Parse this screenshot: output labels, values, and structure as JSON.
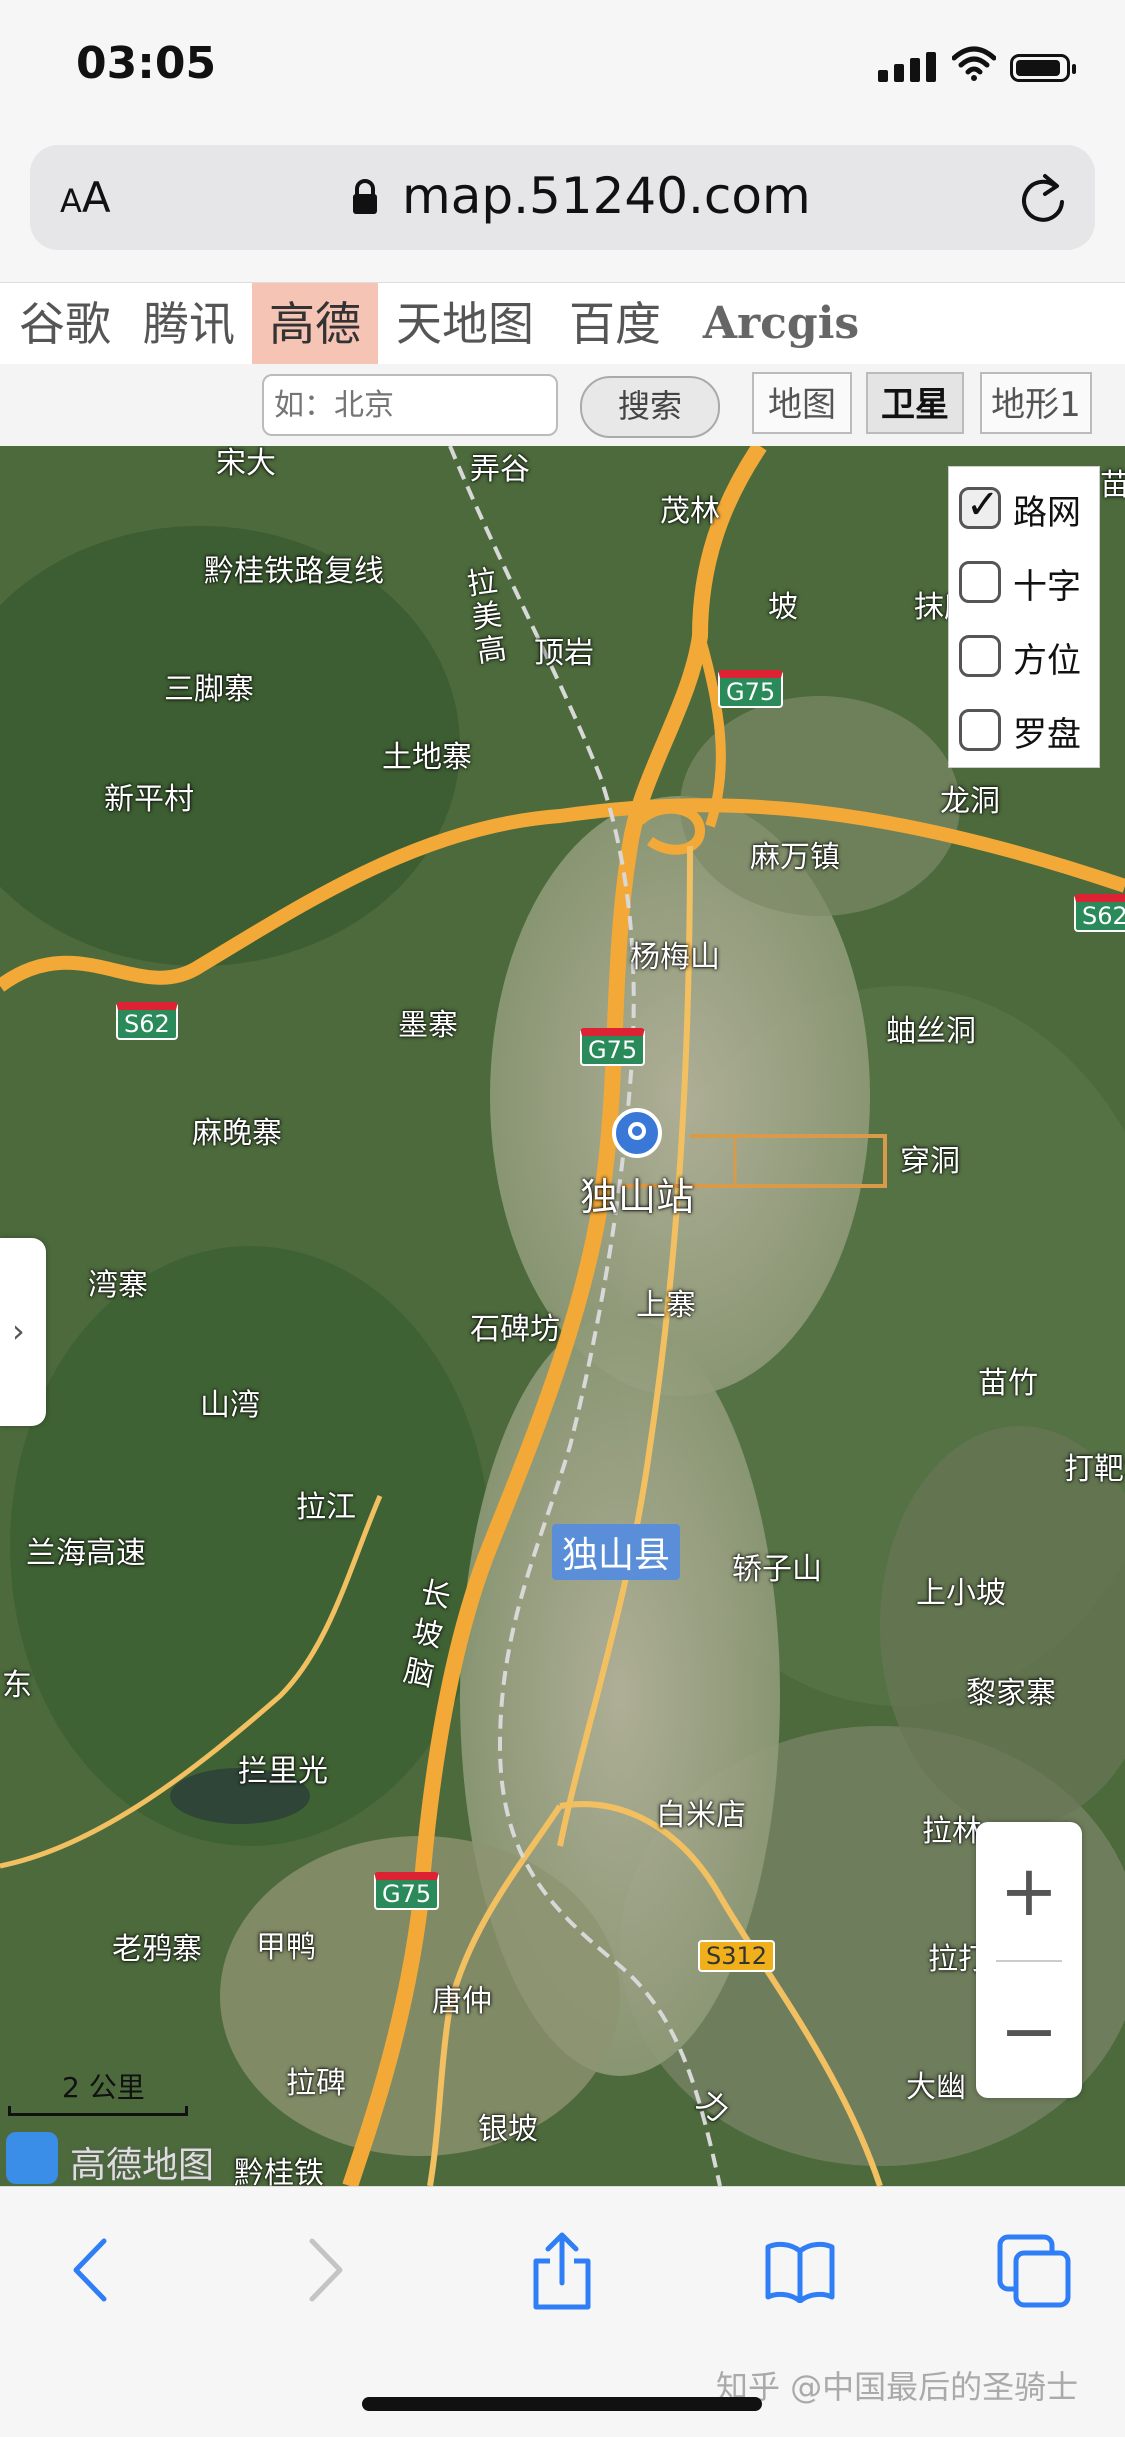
{
  "status_bar": {
    "time": "03:05"
  },
  "browser": {
    "text_size_label": "AA",
    "url": "map.51240.com"
  },
  "providers": [
    {
      "label": "谷歌",
      "active": false
    },
    {
      "label": "腾讯",
      "active": false
    },
    {
      "label": "高德",
      "active": true
    },
    {
      "label": "天地图",
      "active": false
    },
    {
      "label": "百度",
      "active": false
    },
    {
      "label": "Arcgis",
      "active": false
    }
  ],
  "search": {
    "placeholder": "如：北京",
    "button_label": "搜索"
  },
  "map_types": [
    {
      "label": "地图",
      "active": false
    },
    {
      "label": "卫星",
      "active": true
    },
    {
      "label": "地形1",
      "active": false
    }
  ],
  "overlays": [
    {
      "label": "路网",
      "checked": true
    },
    {
      "label": "十字",
      "checked": false
    },
    {
      "label": "方位",
      "checked": false
    },
    {
      "label": "罗盘",
      "checked": false
    }
  ],
  "map": {
    "place_labels": [
      "宋大",
      "弄谷",
      "茂林",
      "黔桂铁路复线",
      "拉美高",
      "顶岩",
      "坡",
      "抹所",
      "三脚寨",
      "土地寨",
      "新平村",
      "龙洞",
      "麻万镇",
      "杨梅山",
      "墨寨",
      "蚰丝洞",
      "麻晚寨",
      "穿洞",
      "湾寨",
      "石碑坊",
      "上寨",
      "山湾",
      "苗竹",
      "打靶场",
      "拉江",
      "兰海高速",
      "长坡脑",
      "轿子山",
      "上小坡",
      "黎家寨",
      "拦里光",
      "白米店",
      "拉林",
      "老鸦寨",
      "甲鸭",
      "唐仲",
      "拉打",
      "拉碑",
      "银坡",
      "大幽",
      "黔桂铁",
      "力",
      "东",
      "苗"
    ],
    "station": "独山站",
    "county": "独山县",
    "road_shields": [
      "G75",
      "G75",
      "G75",
      "S62",
      "S62",
      "S312"
    ]
  },
  "zoom": {
    "in": "+",
    "out": "−"
  },
  "scale": {
    "label": "2 公里"
  },
  "logo": {
    "text": "高德地图"
  },
  "watermark": "知乎 @中国最后的圣骑士"
}
